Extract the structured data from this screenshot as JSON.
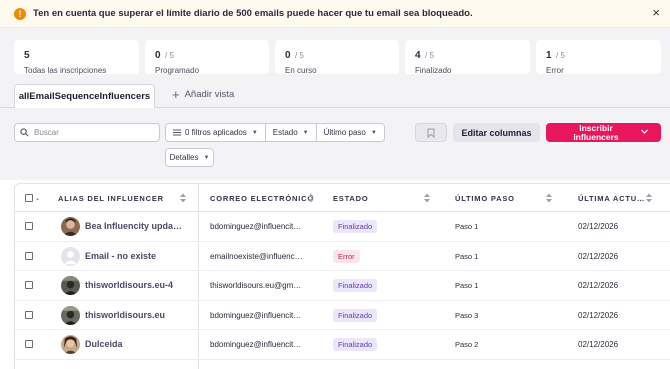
{
  "banner": {
    "icon": "warning-icon",
    "text": "Ten en cuenta que superar el límite diario de 500 emails puede hacer que tu email sea bloqueado.",
    "close_icon": "close-icon",
    "close": "×"
  },
  "stats": [
    {
      "value": "5",
      "total": "",
      "label": "Todas las inscripciones"
    },
    {
      "value": "0",
      "total": "/ 5",
      "label": "Programado"
    },
    {
      "value": "0",
      "total": "/ 5",
      "label": "En curso"
    },
    {
      "value": "4",
      "total": "/ 5",
      "label": "Finalizado"
    },
    {
      "value": "1",
      "total": "/ 5",
      "label": "Error"
    }
  ],
  "tabs": {
    "active": "allEmailSequenceInfluencers",
    "add_label": "Añadir vista"
  },
  "toolbar": {
    "search_placeholder": "Buscar",
    "filters_label": "0 filtros aplicados",
    "estado_label": "Estado",
    "ultimo_paso_label": "Último paso",
    "detalles_label": "Detalles",
    "edit_columns_label": "Editar columnas",
    "enroll_label": "Inscribir influencers",
    "colors": {
      "primary": "#e8175d"
    }
  },
  "table": {
    "headers": [
      "ALIAS DEL INFLUENCER",
      "CORREO ELECTRÓNICO",
      "ESTADO",
      "ÚLTIMO PASO",
      "ÚLTIMA ACTU…"
    ],
    "rows": [
      {
        "alias": "Bea Influencity upda…",
        "email": "bdominguez@influencit…",
        "status": "Finalizado",
        "step": "Paso 1",
        "date": "02/12/2026",
        "avatar": "photo"
      },
      {
        "alias": "Email - no existe",
        "email": "emailnoexiste@influenc…",
        "status": "Error",
        "step": "Paso 1",
        "date": "02/12/2026",
        "avatar": "placeholder"
      },
      {
        "alias": "thisworldisours.eu-4",
        "email": "thisworldisours.eu@gm…",
        "status": "Finalizado",
        "step": "Paso 1",
        "date": "02/12/2026",
        "avatar": "photo"
      },
      {
        "alias": "thisworldisours.eu",
        "email": "bdominguez@influencit…",
        "status": "Finalizado",
        "step": "Paso 3",
        "date": "02/12/2026",
        "avatar": "photo"
      },
      {
        "alias": "Dulceida",
        "email": "bdominguez@influencit…",
        "status": "Finalizado",
        "step": "Paso 2",
        "date": "02/12/2026",
        "avatar": "photo"
      }
    ]
  }
}
